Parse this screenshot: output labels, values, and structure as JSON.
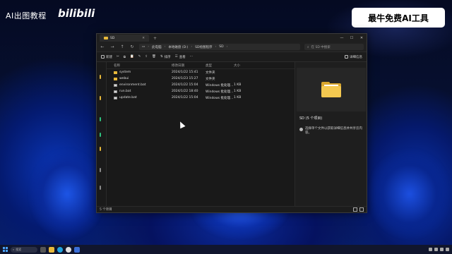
{
  "overlay": {
    "top_left_label": "AI出图教程",
    "bili_logo": "bilibili",
    "promo": "最牛免费AI工具"
  },
  "window": {
    "tab_title": "SD",
    "address": [
      "此电脑",
      "本地磁盘 (D:)",
      "SD绘图程序",
      "SD"
    ],
    "search_placeholder": "在 SD 中搜索",
    "toolbar": {
      "new": "新建",
      "sort": "排序",
      "view": "查看",
      "details": "详细信息"
    },
    "columns": {
      "name": "名称",
      "date": "修改日期",
      "type": "类型",
      "size": "大小"
    },
    "files": [
      {
        "name": "system",
        "date": "2024/1/22 15:41",
        "type": "文件夹",
        "size": "",
        "kind": "folder"
      },
      {
        "name": "webui",
        "date": "2024/1/23 15:27",
        "type": "文件夹",
        "size": "",
        "kind": "folder"
      },
      {
        "name": "environment.bat",
        "date": "2024/1/22 15:04",
        "type": "Windows 批处理...",
        "size": "1 KB",
        "kind": "file"
      },
      {
        "name": "run.bat",
        "date": "2024/1/22 18:40",
        "type": "Windows 批处理...",
        "size": "1 KB",
        "kind": "file"
      },
      {
        "name": "update.bat",
        "date": "2024/1/22 15:04",
        "type": "Windows 批处理...",
        "size": "1 KB",
        "kind": "file"
      }
    ],
    "preview": {
      "title": "SD (5 个项目)",
      "info": "选择单个文件以获取详细信息并共享云内容。"
    },
    "status": "5 个项目"
  },
  "taskbar": {
    "search_label": "搜索"
  },
  "colors": {
    "folder": "#e8b93a",
    "window_bg": "#1c1c1c",
    "accent_blue": "#4aa3ff"
  }
}
